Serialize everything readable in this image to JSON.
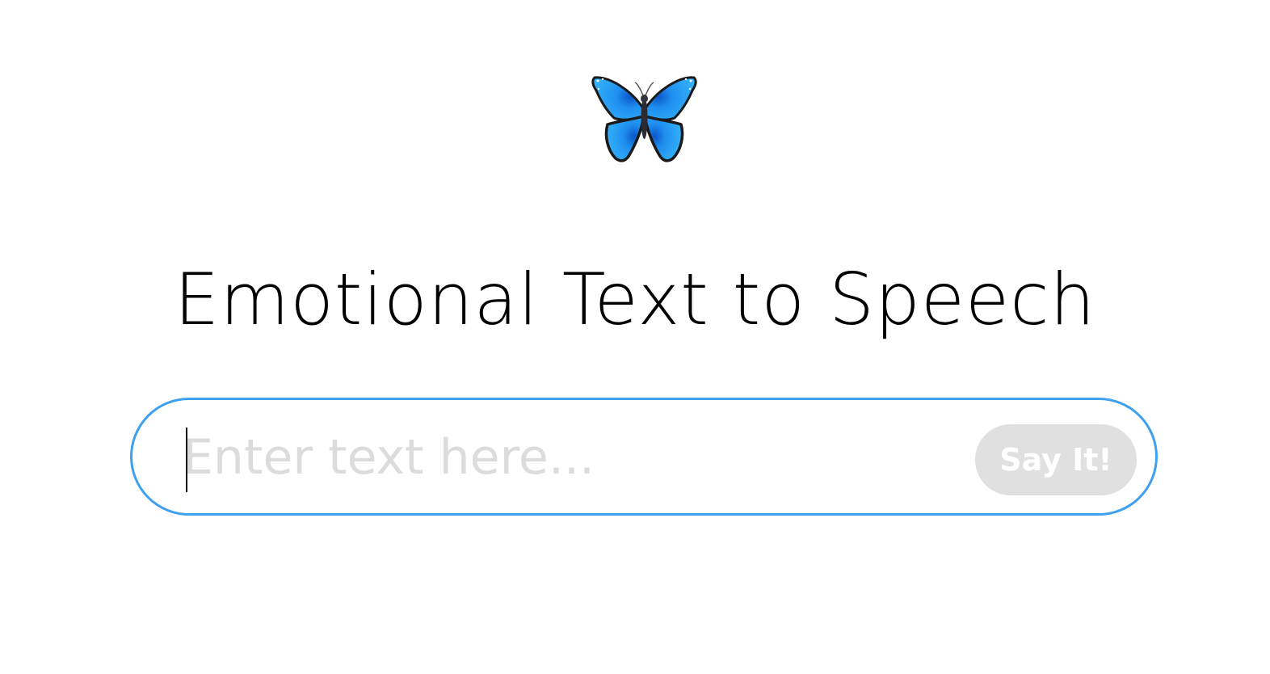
{
  "header": {
    "logo_icon": "butterfly-icon",
    "title": "Emotional Text to Speech"
  },
  "input": {
    "placeholder": "Enter text here...",
    "value": ""
  },
  "button": {
    "label": "Say It!"
  },
  "colors": {
    "accent_border": "#3fa0f0",
    "button_bg": "#e0e0e0",
    "placeholder": "#dcdcdc",
    "butterfly_blue": "#2aa4f4"
  }
}
